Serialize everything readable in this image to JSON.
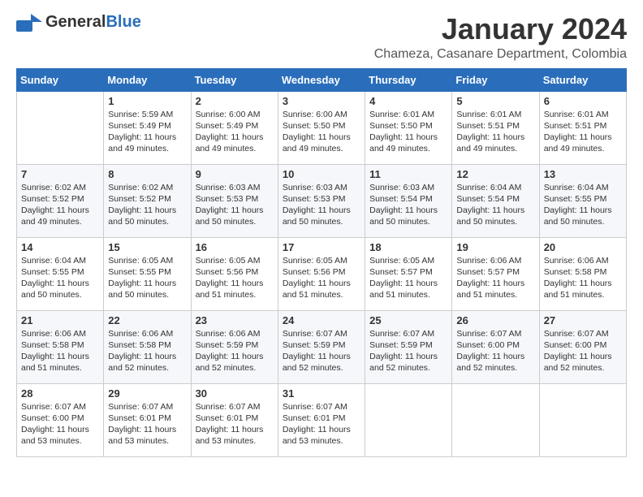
{
  "header": {
    "logo_general": "General",
    "logo_blue": "Blue",
    "month_title": "January 2024",
    "location": "Chameza, Casanare Department, Colombia"
  },
  "calendar": {
    "days_of_week": [
      "Sunday",
      "Monday",
      "Tuesday",
      "Wednesday",
      "Thursday",
      "Friday",
      "Saturday"
    ],
    "weeks": [
      [
        {
          "day": "",
          "info": ""
        },
        {
          "day": "1",
          "info": "Sunrise: 5:59 AM\nSunset: 5:49 PM\nDaylight: 11 hours\nand 49 minutes."
        },
        {
          "day": "2",
          "info": "Sunrise: 6:00 AM\nSunset: 5:49 PM\nDaylight: 11 hours\nand 49 minutes."
        },
        {
          "day": "3",
          "info": "Sunrise: 6:00 AM\nSunset: 5:50 PM\nDaylight: 11 hours\nand 49 minutes."
        },
        {
          "day": "4",
          "info": "Sunrise: 6:01 AM\nSunset: 5:50 PM\nDaylight: 11 hours\nand 49 minutes."
        },
        {
          "day": "5",
          "info": "Sunrise: 6:01 AM\nSunset: 5:51 PM\nDaylight: 11 hours\nand 49 minutes."
        },
        {
          "day": "6",
          "info": "Sunrise: 6:01 AM\nSunset: 5:51 PM\nDaylight: 11 hours\nand 49 minutes."
        }
      ],
      [
        {
          "day": "7",
          "info": "Sunrise: 6:02 AM\nSunset: 5:52 PM\nDaylight: 11 hours\nand 49 minutes."
        },
        {
          "day": "8",
          "info": "Sunrise: 6:02 AM\nSunset: 5:52 PM\nDaylight: 11 hours\nand 50 minutes."
        },
        {
          "day": "9",
          "info": "Sunrise: 6:03 AM\nSunset: 5:53 PM\nDaylight: 11 hours\nand 50 minutes."
        },
        {
          "day": "10",
          "info": "Sunrise: 6:03 AM\nSunset: 5:53 PM\nDaylight: 11 hours\nand 50 minutes."
        },
        {
          "day": "11",
          "info": "Sunrise: 6:03 AM\nSunset: 5:54 PM\nDaylight: 11 hours\nand 50 minutes."
        },
        {
          "day": "12",
          "info": "Sunrise: 6:04 AM\nSunset: 5:54 PM\nDaylight: 11 hours\nand 50 minutes."
        },
        {
          "day": "13",
          "info": "Sunrise: 6:04 AM\nSunset: 5:55 PM\nDaylight: 11 hours\nand 50 minutes."
        }
      ],
      [
        {
          "day": "14",
          "info": "Sunrise: 6:04 AM\nSunset: 5:55 PM\nDaylight: 11 hours\nand 50 minutes."
        },
        {
          "day": "15",
          "info": "Sunrise: 6:05 AM\nSunset: 5:55 PM\nDaylight: 11 hours\nand 50 minutes."
        },
        {
          "day": "16",
          "info": "Sunrise: 6:05 AM\nSunset: 5:56 PM\nDaylight: 11 hours\nand 51 minutes."
        },
        {
          "day": "17",
          "info": "Sunrise: 6:05 AM\nSunset: 5:56 PM\nDaylight: 11 hours\nand 51 minutes."
        },
        {
          "day": "18",
          "info": "Sunrise: 6:05 AM\nSunset: 5:57 PM\nDaylight: 11 hours\nand 51 minutes."
        },
        {
          "day": "19",
          "info": "Sunrise: 6:06 AM\nSunset: 5:57 PM\nDaylight: 11 hours\nand 51 minutes."
        },
        {
          "day": "20",
          "info": "Sunrise: 6:06 AM\nSunset: 5:58 PM\nDaylight: 11 hours\nand 51 minutes."
        }
      ],
      [
        {
          "day": "21",
          "info": "Sunrise: 6:06 AM\nSunset: 5:58 PM\nDaylight: 11 hours\nand 51 minutes."
        },
        {
          "day": "22",
          "info": "Sunrise: 6:06 AM\nSunset: 5:58 PM\nDaylight: 11 hours\nand 52 minutes."
        },
        {
          "day": "23",
          "info": "Sunrise: 6:06 AM\nSunset: 5:59 PM\nDaylight: 11 hours\nand 52 minutes."
        },
        {
          "day": "24",
          "info": "Sunrise: 6:07 AM\nSunset: 5:59 PM\nDaylight: 11 hours\nand 52 minutes."
        },
        {
          "day": "25",
          "info": "Sunrise: 6:07 AM\nSunset: 5:59 PM\nDaylight: 11 hours\nand 52 minutes."
        },
        {
          "day": "26",
          "info": "Sunrise: 6:07 AM\nSunset: 6:00 PM\nDaylight: 11 hours\nand 52 minutes."
        },
        {
          "day": "27",
          "info": "Sunrise: 6:07 AM\nSunset: 6:00 PM\nDaylight: 11 hours\nand 52 minutes."
        }
      ],
      [
        {
          "day": "28",
          "info": "Sunrise: 6:07 AM\nSunset: 6:00 PM\nDaylight: 11 hours\nand 53 minutes."
        },
        {
          "day": "29",
          "info": "Sunrise: 6:07 AM\nSunset: 6:01 PM\nDaylight: 11 hours\nand 53 minutes."
        },
        {
          "day": "30",
          "info": "Sunrise: 6:07 AM\nSunset: 6:01 PM\nDaylight: 11 hours\nand 53 minutes."
        },
        {
          "day": "31",
          "info": "Sunrise: 6:07 AM\nSunset: 6:01 PM\nDaylight: 11 hours\nand 53 minutes."
        },
        {
          "day": "",
          "info": ""
        },
        {
          "day": "",
          "info": ""
        },
        {
          "day": "",
          "info": ""
        }
      ]
    ]
  }
}
